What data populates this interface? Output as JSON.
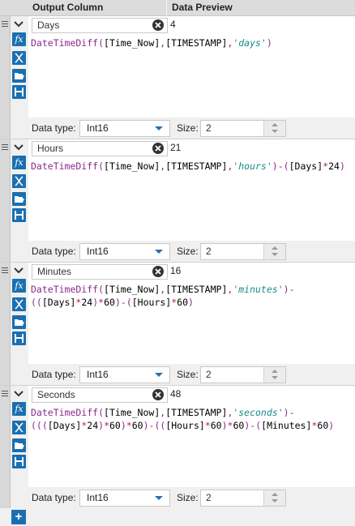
{
  "header": {
    "output_column": "Output Column",
    "data_preview": "Data Preview"
  },
  "labels": {
    "data_type": "Data type:",
    "size": "Size:"
  },
  "rows": [
    {
      "name": "Days",
      "preview": "4",
      "formula_lines": [
        [
          [
            "fn",
            "DateTimeDiff("
          ],
          [
            "fld",
            "[Time_Now]"
          ],
          [
            "fn",
            ","
          ],
          [
            "fld",
            "[TIMESTAMP]"
          ],
          [
            "fn",
            ","
          ],
          [
            "str",
            "'days'"
          ],
          [
            "fn",
            ")"
          ]
        ]
      ],
      "data_type": "Int16",
      "size": "2"
    },
    {
      "name": "Hours",
      "preview": "21",
      "formula_lines": [
        [
          [
            "fn",
            "DateTimeDiff("
          ],
          [
            "fld",
            "[Time_Now]"
          ],
          [
            "fn",
            ","
          ],
          [
            "fld",
            "[TIMESTAMP]"
          ],
          [
            "fn",
            ","
          ],
          [
            "str",
            "'hours'"
          ],
          [
            "fn",
            ")"
          ],
          [
            "op",
            "-"
          ],
          [
            "fn",
            "("
          ],
          [
            "fld",
            "[Days]"
          ],
          [
            "op",
            "*"
          ],
          [
            "num",
            "24"
          ],
          [
            "fn",
            ")"
          ]
        ]
      ],
      "data_type": "Int16",
      "size": "2"
    },
    {
      "name": "Minutes",
      "preview": "16",
      "formula_lines": [
        [
          [
            "fn",
            "DateTimeDiff("
          ],
          [
            "fld",
            "[Time_Now]"
          ],
          [
            "fn",
            ","
          ],
          [
            "fld",
            "[TIMESTAMP]"
          ],
          [
            "fn",
            ","
          ],
          [
            "str",
            "'minutes'"
          ],
          [
            "fn",
            ")"
          ],
          [
            "op",
            "-"
          ]
        ],
        [
          [
            "fn",
            "(("
          ],
          [
            "fld",
            "[Days]"
          ],
          [
            "op",
            "*"
          ],
          [
            "num",
            "24"
          ],
          [
            "fn",
            ")"
          ],
          [
            "op",
            "*"
          ],
          [
            "num",
            "60"
          ],
          [
            "fn",
            ")"
          ],
          [
            "op",
            "-"
          ],
          [
            "fn",
            "("
          ],
          [
            "fld",
            "[Hours]"
          ],
          [
            "op",
            "*"
          ],
          [
            "num",
            "60"
          ],
          [
            "fn",
            ")"
          ]
        ]
      ],
      "data_type": "Int16",
      "size": "2"
    },
    {
      "name": "Seconds",
      "preview": "48",
      "formula_lines": [
        [
          [
            "fn",
            "DateTimeDiff("
          ],
          [
            "fld",
            "[Time_Now]"
          ],
          [
            "fn",
            ","
          ],
          [
            "fld",
            "[TIMESTAMP]"
          ],
          [
            "fn",
            ","
          ],
          [
            "str",
            "'seconds'"
          ],
          [
            "fn",
            ")"
          ],
          [
            "op",
            "-"
          ]
        ],
        [
          [
            "fn",
            "((("
          ],
          [
            "fld",
            "[Days]"
          ],
          [
            "op",
            "*"
          ],
          [
            "num",
            "24"
          ],
          [
            "fn",
            ")"
          ],
          [
            "op",
            "*"
          ],
          [
            "num",
            "60"
          ],
          [
            "fn",
            ")"
          ],
          [
            "op",
            "*"
          ],
          [
            "num",
            "60"
          ],
          [
            "fn",
            ")"
          ],
          [
            "op",
            "-"
          ],
          [
            "fn",
            "(("
          ],
          [
            "fld",
            "[Hours]"
          ],
          [
            "op",
            "*"
          ],
          [
            "num",
            "60"
          ],
          [
            "fn",
            ")"
          ],
          [
            "op",
            "*"
          ],
          [
            "num",
            "60"
          ],
          [
            "fn",
            ")"
          ],
          [
            "op",
            "-"
          ],
          [
            "fn",
            "("
          ],
          [
            "fld",
            "[Minutes]"
          ],
          [
            "op",
            "*"
          ],
          [
            "num",
            "60"
          ],
          [
            "fn",
            ")"
          ]
        ]
      ],
      "data_type": "Int16",
      "size": "2"
    }
  ],
  "icons": {
    "expression": "fx-icon",
    "variable": "variable-icon",
    "open": "folder-open-icon",
    "save": "save-icon",
    "clear": "clear-icon",
    "collapse": "chevron-down-icon",
    "add": "add-icon"
  },
  "add_button": "+"
}
